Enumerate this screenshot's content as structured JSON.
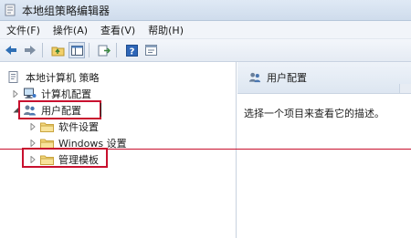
{
  "window": {
    "title": "本地组策略编辑器",
    "app_icon": "policy-editor-icon"
  },
  "menu": {
    "items": [
      {
        "label": "文件(F)"
      },
      {
        "label": "操作(A)"
      },
      {
        "label": "查看(V)"
      },
      {
        "label": "帮助(H)"
      }
    ]
  },
  "toolbar": {
    "buttons": [
      {
        "icon": "back-arrow-icon"
      },
      {
        "icon": "forward-arrow-icon"
      },
      {
        "icon": "up-folder-icon"
      },
      {
        "icon": "show-hide-tree-icon"
      },
      {
        "icon": "export-list-icon"
      },
      {
        "icon": "help-icon"
      },
      {
        "icon": "properties-icon"
      }
    ]
  },
  "tree": {
    "root": {
      "label": "本地计算机 策略",
      "icon": "policy-document-icon"
    },
    "computer_config": {
      "label": "计算机配置",
      "icon": "computer-icon"
    },
    "user_config": {
      "label": "用户配置",
      "icon": "users-icon"
    },
    "software_settings": {
      "label": "软件设置",
      "icon": "folder-icon"
    },
    "windows_settings": {
      "label": "Windows 设置",
      "icon": "folder-icon"
    },
    "admin_templates": {
      "label": "管理模板",
      "icon": "folder-icon"
    }
  },
  "detail": {
    "header_title": "用户配置",
    "header_icon": "users-icon",
    "description": "选择一个项目来查看它的描述。"
  },
  "annotations": {
    "highlight_color": "#c8102e"
  }
}
